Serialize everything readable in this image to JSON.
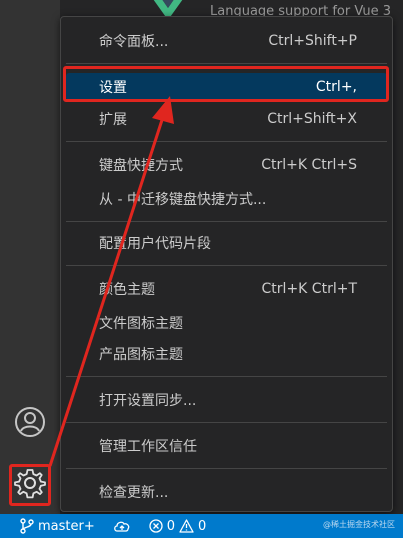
{
  "background": {
    "extension_description": "Language support for Vue 3"
  },
  "menu": {
    "items": [
      {
        "label": "命令面板...",
        "shortcut": "Ctrl+Shift+P"
      },
      {
        "label": "设置",
        "shortcut": "Ctrl+,"
      },
      {
        "label": "扩展",
        "shortcut": "Ctrl+Shift+X"
      },
      {
        "label": "键盘快捷方式",
        "shortcut": "Ctrl+K Ctrl+S"
      },
      {
        "label": "从 - 中迁移键盘快捷方式...",
        "shortcut": ""
      },
      {
        "label": "配置用户代码片段",
        "shortcut": ""
      },
      {
        "label": "颜色主题",
        "shortcut": "Ctrl+K Ctrl+T"
      },
      {
        "label": "文件图标主题",
        "shortcut": ""
      },
      {
        "label": "产品图标主题",
        "shortcut": ""
      },
      {
        "label": "打开设置同步...",
        "shortcut": ""
      },
      {
        "label": "管理工作区信任",
        "shortcut": ""
      },
      {
        "label": "检查更新...",
        "shortcut": ""
      }
    ],
    "highlighted_item": "设置"
  },
  "activity_bar": {
    "icons": [
      "account-icon",
      "gear-icon"
    ]
  },
  "status_bar": {
    "branch": "master+",
    "errors": "0",
    "warnings": "0",
    "watermark": "@稀土掘金技术社区"
  },
  "colors": {
    "accent": "#007acc",
    "highlight": "#04395e",
    "annotation_red": "#e0261f"
  }
}
